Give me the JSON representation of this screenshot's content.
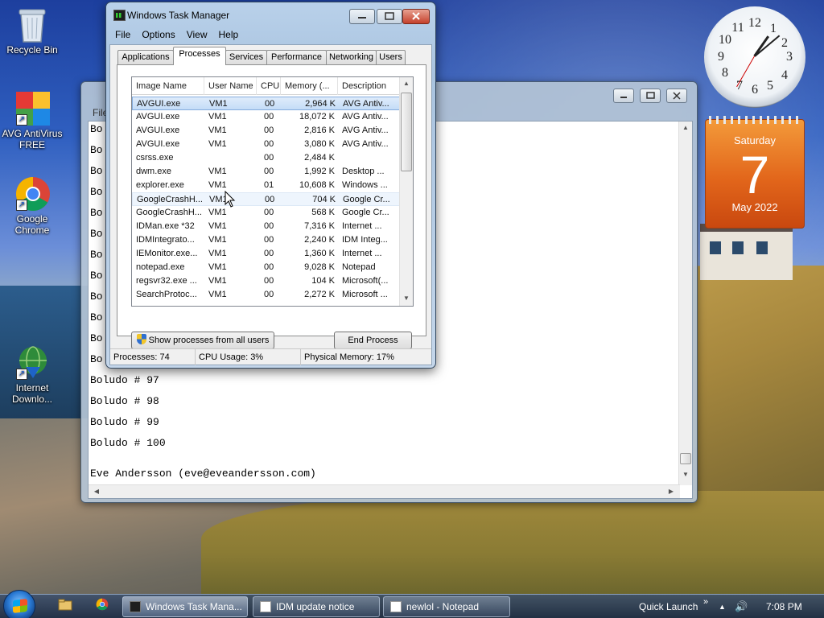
{
  "desktop": {
    "icons": [
      {
        "label": "Recycle Bin"
      },
      {
        "label": "AVG AntiVirus FREE"
      },
      {
        "label": "Google Chrome"
      },
      {
        "label": "Internet Downlo..."
      }
    ]
  },
  "clock": {
    "numbers": [
      "12",
      "1",
      "2",
      "3",
      "4",
      "5",
      "6",
      "7",
      "8",
      "9",
      "10",
      "11"
    ]
  },
  "calendar": {
    "day": "Saturday",
    "date": "7",
    "month": "May 2022"
  },
  "notepad": {
    "menu_first": "File",
    "lines": [
      "Bo",
      "Bo",
      "Bo",
      "Bo",
      "Bo",
      "Bo",
      "Bo",
      "Bo",
      "Bo",
      "Bo",
      "Bo",
      "Bo",
      "Boludo # 97",
      "Boludo # 98",
      "Boludo # 99",
      "Boludo # 100",
      "Eve Andersson (eve@eveandersson.com)"
    ]
  },
  "taskmgr": {
    "title": "Windows Task Manager",
    "menu": [
      "File",
      "Options",
      "View",
      "Help"
    ],
    "tabs": [
      "Applications",
      "Processes",
      "Services",
      "Performance",
      "Networking",
      "Users"
    ],
    "columns": [
      "Image Name",
      "User Name",
      "CPU",
      "Memory (...",
      "Description"
    ],
    "rows": [
      [
        "AVGUI.exe",
        "VM1",
        "00",
        "2,964 K",
        "AVG Antiv..."
      ],
      [
        "AVGUI.exe",
        "VM1",
        "00",
        "18,072 K",
        "AVG Antiv..."
      ],
      [
        "AVGUI.exe",
        "VM1",
        "00",
        "2,816 K",
        "AVG Antiv..."
      ],
      [
        "AVGUI.exe",
        "VM1",
        "00",
        "3,080 K",
        "AVG Antiv..."
      ],
      [
        "csrss.exe",
        "",
        "00",
        "2,484 K",
        ""
      ],
      [
        "dwm.exe",
        "VM1",
        "00",
        "1,992 K",
        "Desktop ..."
      ],
      [
        "explorer.exe",
        "VM1",
        "01",
        "10,608 K",
        "Windows ..."
      ],
      [
        "GoogleCrashH...",
        "VM1",
        "00",
        "704 K",
        "Google Cr..."
      ],
      [
        "GoogleCrashH...",
        "VM1",
        "00",
        "568 K",
        "Google Cr..."
      ],
      [
        "IDMan.exe *32",
        "VM1",
        "00",
        "7,316 K",
        "Internet ..."
      ],
      [
        "IDMIntegrato...",
        "VM1",
        "00",
        "2,240 K",
        "IDM Integ..."
      ],
      [
        "IEMonitor.exe...",
        "VM1",
        "00",
        "1,360 K",
        "Internet ..."
      ],
      [
        "notepad.exe",
        "VM1",
        "00",
        "9,028 K",
        "Notepad"
      ],
      [
        "regsvr32.exe ...",
        "VM1",
        "00",
        "104 K",
        "Microsoft(..."
      ],
      [
        "SearchProtoc...",
        "VM1",
        "00",
        "2,272 K",
        "Microsoft ..."
      ]
    ],
    "show_all_label": "Show processes from all users",
    "end_process_label": "End Process",
    "status": {
      "processes": "Processes: 74",
      "cpu": "CPU Usage: 3%",
      "memory": "Physical Memory: 17%"
    }
  },
  "taskbar": {
    "tasks": [
      "Windows Task Mana...",
      "IDM update notice",
      "newlol - Notepad"
    ],
    "quick_launch": "Quick Launch",
    "quick_launch_chevron": "»",
    "tray_up": "▲",
    "speaker": "🔊",
    "time": "7:08 PM"
  }
}
